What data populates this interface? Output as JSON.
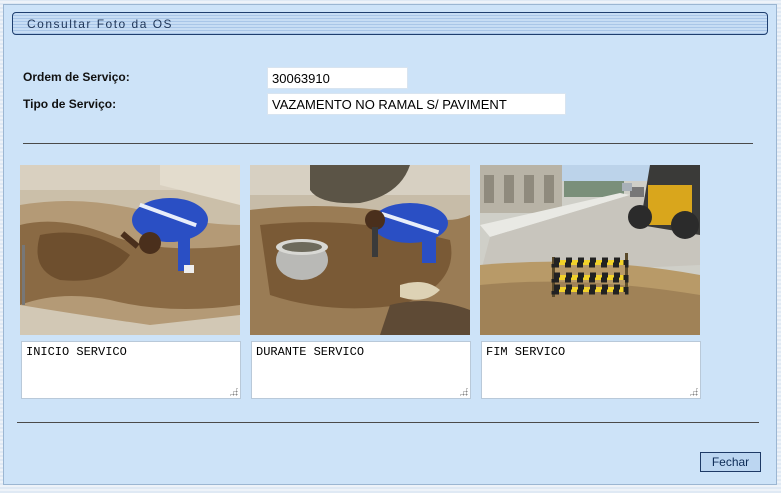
{
  "window": {
    "title": "Consultar Foto da OS"
  },
  "form": {
    "ordem_label": "Ordem de Serviço:",
    "ordem_value": "30063910",
    "tipo_label": "Tipo de Serviço:",
    "tipo_value": "VAZAMENTO NO RAMAL S/ PAVIMENT"
  },
  "photos": [
    {
      "caption": "INICIO SERVICO",
      "description": "worker in blue uniform digging in dirt"
    },
    {
      "caption": "DURANTE SERVICO",
      "description": "worker digging next to a bucket"
    },
    {
      "caption": "FIM SERVICO",
      "description": "street with barrier tape and excavator"
    }
  ],
  "actions": {
    "close_label": "Fechar"
  },
  "colors": {
    "panel": "#cde3f8",
    "title_border": "#1f3f6f",
    "uniform": "#2a4fc4"
  }
}
